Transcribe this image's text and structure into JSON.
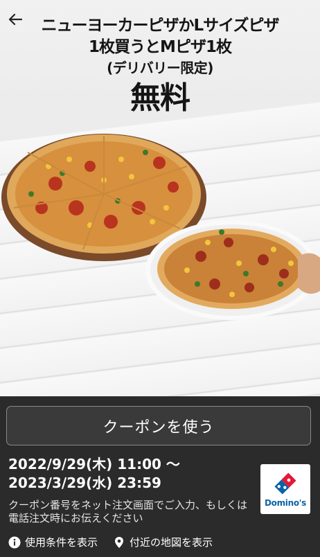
{
  "header": {
    "back_icon": "arrow-left-icon",
    "headline_line1": "ニューヨーカーピザかLサイズピザ",
    "headline_line2": "1枚買うとMピザ1枚",
    "headline_line3": "(デリバリー限定)",
    "headline_line4": "無料"
  },
  "coupon": {
    "use_button": "クーポンを使う",
    "period_start": "2022/9/29(木) 11:00 〜",
    "period_end": "2023/3/29(水) 23:59",
    "note": "クーポン番号をネット注文画面でご入力、もしくは電話注文時にお伝えください",
    "brand": "Domino's"
  },
  "links": {
    "terms": "使用条件を表示",
    "map": "付近の地図を表示",
    "terms_icon": "info-icon",
    "map_icon": "map-pin-icon"
  }
}
